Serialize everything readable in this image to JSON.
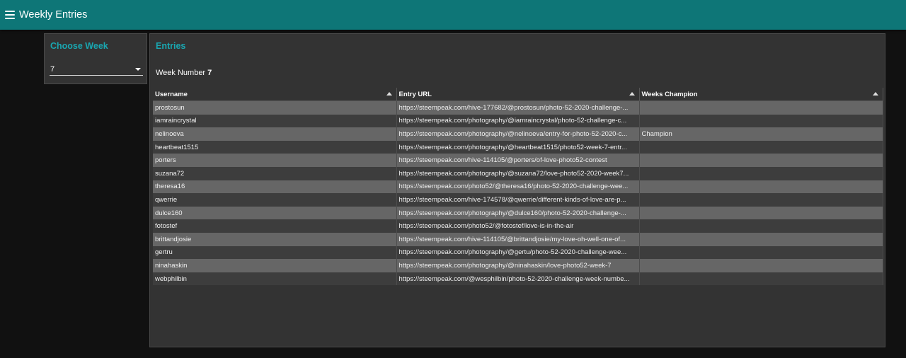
{
  "header": {
    "title": "Weekly Entries",
    "menu_icon": "menu-icon"
  },
  "week_panel": {
    "title": "Choose Week",
    "selected": "7"
  },
  "entries_panel": {
    "title": "Entries",
    "week_label": "Week Number",
    "week_value": "7"
  },
  "table": {
    "columns": [
      "Username",
      "Entry URL",
      "Weeks Champion"
    ],
    "rows": [
      {
        "username": "prostosun",
        "url": "https://steempeak.com/hive-177682/@prostosun/photo-52-2020-challenge-...",
        "champion": ""
      },
      {
        "username": "iamraincrystal",
        "url": "https://steempeak.com/photography/@iamraincrystal/photo-52-challenge-c...",
        "champion": ""
      },
      {
        "username": "nelinoeva",
        "url": "https://steempeak.com/photography/@nelinoeva/entry-for-photo-52-2020-c...",
        "champion": "Champion"
      },
      {
        "username": "heartbeat1515",
        "url": "https://steempeak.com/photography/@heartbeat1515/photo52-week-7-entr...",
        "champion": ""
      },
      {
        "username": "porters",
        "url": "https://steempeak.com/hive-114105/@porters/of-love-photo52-contest",
        "champion": ""
      },
      {
        "username": "suzana72",
        "url": "https://steempeak.com/photography/@suzana72/love-photo52-2020-week7...",
        "champion": ""
      },
      {
        "username": "theresa16",
        "url": "https://steempeak.com/photo52/@theresa16/photo-52-2020-challenge-wee...",
        "champion": ""
      },
      {
        "username": "qwerrie",
        "url": "https://steempeak.com/hive-174578/@qwerrie/different-kinds-of-love-are-p...",
        "champion": ""
      },
      {
        "username": "dulce160",
        "url": "https://steempeak.com/photography/@dulce160/photo-52-2020-challenge-...",
        "champion": ""
      },
      {
        "username": "fotostef",
        "url": "https://steempeak.com/photo52/@fotostef/love-is-in-the-air",
        "champion": ""
      },
      {
        "username": "brittandjosie",
        "url": "https://steempeak.com/hive-114105/@brittandjosie/my-love-oh-well-one-of...",
        "champion": ""
      },
      {
        "username": "gertru",
        "url": "https://steempeak.com/photography/@gertu/photo-52-2020-challenge-wee...",
        "champion": ""
      },
      {
        "username": "ninahaskin",
        "url": "https://steempeak.com/photography/@ninahaskin/love-photo52-week-7",
        "champion": ""
      },
      {
        "username": "webphilbin",
        "url": "https://steempeak.com/@wesphilbin/photo-52-2020-challenge-week-numbe...",
        "champion": ""
      }
    ]
  },
  "colors": {
    "topbar": "#0e7677",
    "accent": "#19a7b1",
    "background": "#111111",
    "panel": "#333333"
  }
}
